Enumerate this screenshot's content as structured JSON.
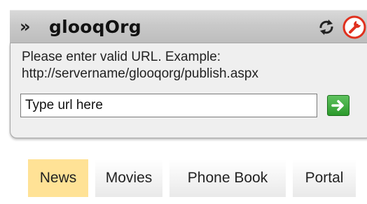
{
  "header": {
    "title": "glooqOrg",
    "chevron_glyph": "»",
    "icons": [
      "chevron-right-double-icon",
      "refresh-icon",
      "settings-wrench-icon"
    ],
    "settings_icon_color": "#e0301e"
  },
  "settings_panel": {
    "instruction_line1": "Please enter valid URL. Example:",
    "instruction_line2": "http://servername/glooqorg/publish.aspx",
    "url_input": {
      "value": "",
      "placeholder": "Type url here"
    },
    "go_button_color": "#3aa83a"
  },
  "tabs": [
    {
      "label": "News",
      "active": true
    },
    {
      "label": "Movies",
      "active": false
    },
    {
      "label": "Phone Book",
      "active": false
    },
    {
      "label": "Portal",
      "active": false
    }
  ],
  "colors": {
    "header_gradient_top": "#d9d9d9",
    "header_gradient_bottom": "#bdbdbd",
    "panel_bg": "#efefef",
    "active_tab": "#ffe296"
  }
}
